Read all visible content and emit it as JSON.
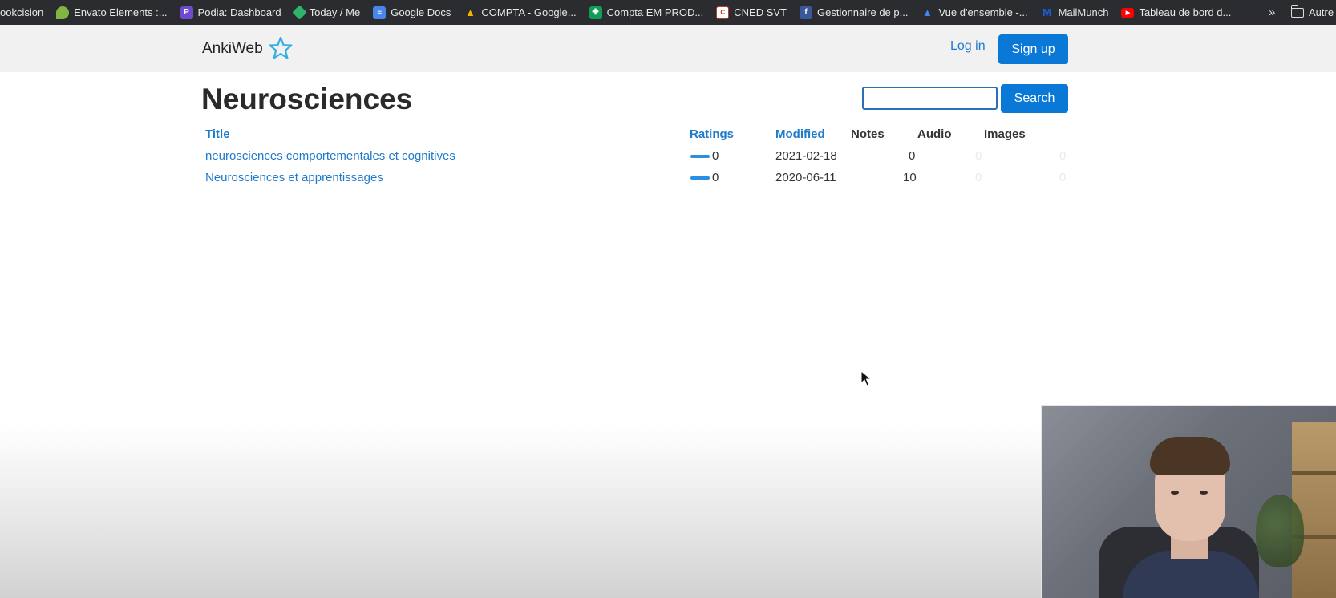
{
  "bookmarks": {
    "items": [
      {
        "label": "ookcision",
        "icon": "none"
      },
      {
        "label": "Envato Elements :...",
        "icon": "envato-leaf-icon",
        "color": "#82b541"
      },
      {
        "label": "Podia: Dashboard",
        "icon": "podia-icon",
        "color": "#6c4bd1",
        "glyph": "P"
      },
      {
        "label": "Today / Me",
        "icon": "today-icon",
        "color": "#2fb36b",
        "glyph": "€"
      },
      {
        "label": "Google Docs",
        "icon": "google-docs-icon",
        "color": "#4a86e8",
        "glyph": "≡"
      },
      {
        "label": "COMPTA - Google...",
        "icon": "google-drive-icon",
        "color": "#f4b400",
        "glyph": "▲"
      },
      {
        "label": "Compta EM PROD...",
        "icon": "google-sheets-icon",
        "color": "#0f9d58",
        "glyph": "✚"
      },
      {
        "label": "CNED SVT",
        "icon": "cned-icon",
        "color": "#c0392b",
        "glyph": "C"
      },
      {
        "label": "Gestionnaire de p...",
        "icon": "facebook-icon",
        "color": "#3b5998",
        "glyph": "f"
      },
      {
        "label": "Vue d'ensemble -...",
        "icon": "google-ads-icon",
        "color": "#4285f4",
        "glyph": "▲"
      },
      {
        "label": "MailMunch",
        "icon": "mailmunch-icon",
        "color": "#1e5bd6",
        "glyph": "M"
      },
      {
        "label": "Tableau de bord d...",
        "icon": "youtube-icon",
        "color": "#ff0000",
        "glyph": "▶"
      }
    ],
    "more": "»",
    "other": "Autre"
  },
  "header": {
    "brand": "AnkiWeb",
    "login": "Log in",
    "signup": "Sign up"
  },
  "page": {
    "title": "Neurosciences",
    "search_value": "",
    "search_button": "Search"
  },
  "table": {
    "headers": {
      "title": "Title",
      "ratings": "Ratings",
      "modified": "Modified",
      "notes": "Notes",
      "audio": "Audio",
      "images": "Images"
    },
    "rows": [
      {
        "title": "neurosciences comportementales et cognitives",
        "rating": "0",
        "modified": "2021-02-18",
        "notes": "0",
        "audio": "0",
        "images": "0"
      },
      {
        "title": "Neurosciences et apprentissages",
        "rating": "0",
        "modified": "2020-06-11",
        "notes": "10",
        "audio": "0",
        "images": "0"
      }
    ]
  },
  "colors": {
    "accent": "#0a78d7",
    "link": "#1e7acb",
    "bookmarks_bg": "#2b2c2f",
    "header_bg": "#f1f1f1"
  }
}
